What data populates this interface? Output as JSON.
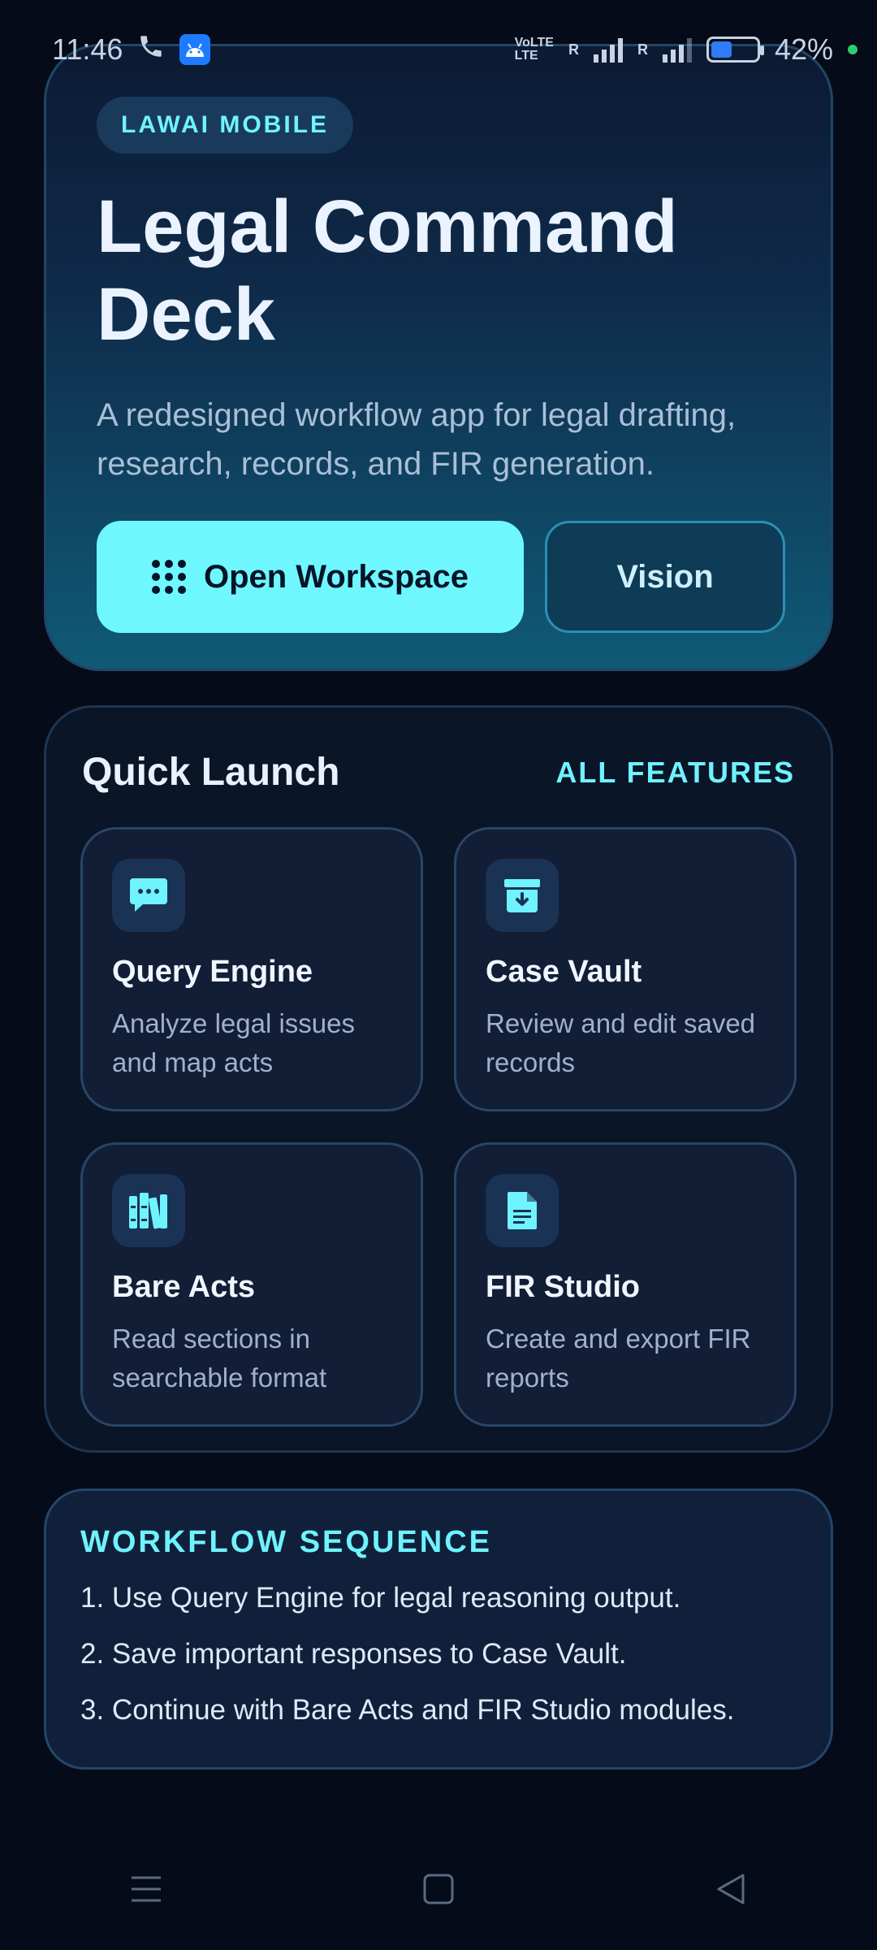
{
  "status_bar": {
    "time": "11:46",
    "network_label_top": "VoLTE",
    "network_label_bottom": "LTE",
    "roaming_1": "R",
    "roaming_2": "R",
    "battery_percent": "42%",
    "battery_level": 0.42,
    "icons": [
      "call-icon",
      "android-icon",
      "signal-icon",
      "battery-icon"
    ]
  },
  "hero": {
    "badge": "LAWAI MOBILE",
    "title": "Legal Command Deck",
    "subtitle": "A redesigned workflow app for legal drafting, research, records, and FIR generation.",
    "primary_button": "Open Workspace",
    "secondary_button": "Vision"
  },
  "quick_launch": {
    "title": "Quick Launch",
    "link": "ALL FEATURES",
    "tiles": [
      {
        "title": "Query Engine",
        "description": "Analyze legal issues and map acts",
        "icon": "chat-icon"
      },
      {
        "title": "Case Vault",
        "description": "Review and edit saved records",
        "icon": "archive-icon"
      },
      {
        "title": "Bare Acts",
        "description": "Read sections in searchable format",
        "icon": "books-icon"
      },
      {
        "title": "FIR Studio",
        "description": "Create and export FIR reports",
        "icon": "document-icon"
      }
    ]
  },
  "workflow": {
    "title": "WORKFLOW SEQUENCE",
    "steps": [
      "1. Use Query Engine for legal reasoning output.",
      "2. Save important responses to Case Vault.",
      "3. Continue with Bare Acts and FIR Studio modules."
    ]
  },
  "colors": {
    "background": "#050b18",
    "accent": "#6ff3ff",
    "primary_button": "#6ff7ff",
    "card": "#0b1528"
  }
}
